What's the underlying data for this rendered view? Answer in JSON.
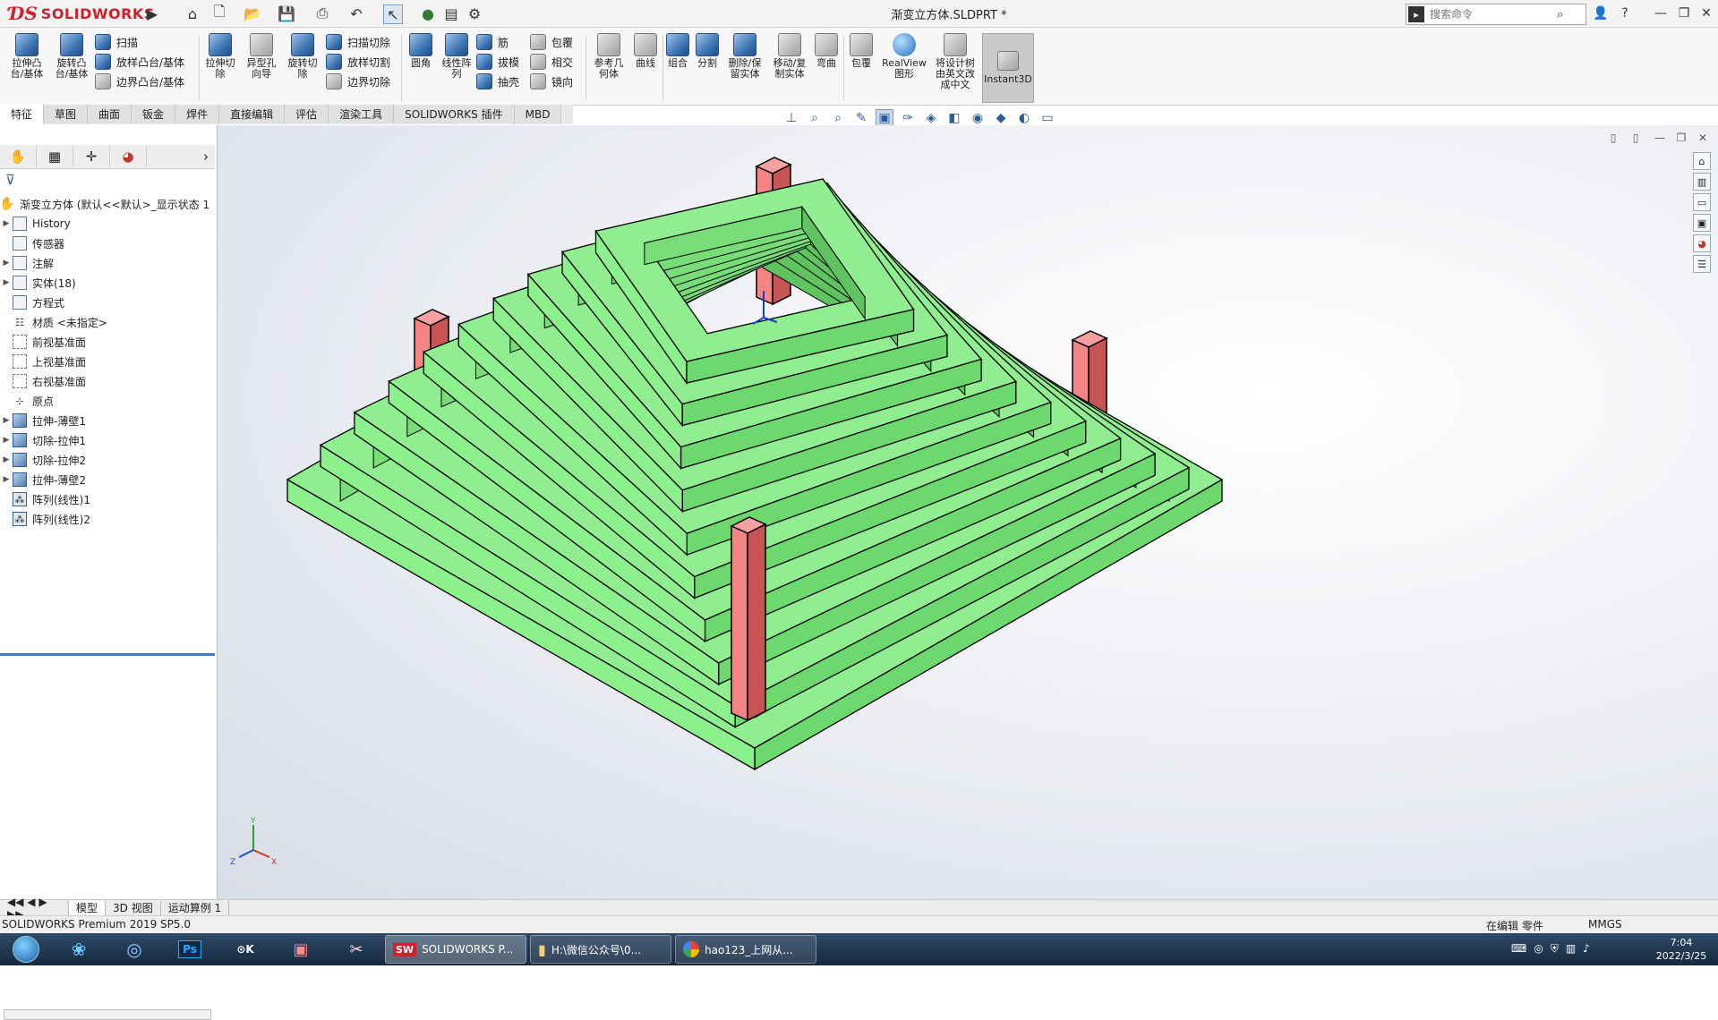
{
  "app": {
    "brand": "SOLIDWORKS",
    "doc_title": "渐变立方体.SLDPRT *"
  },
  "search": {
    "placeholder": "搜索命令"
  },
  "ribbon": {
    "extrude_boss": "拉伸凸\n台/基体",
    "revolve_boss": "旋转凸\n台/基体",
    "sweep": "扫描",
    "loft_boss": "放样凸台/基体",
    "boundary_boss": "边界凸台/基体",
    "extrude_cut": "拉伸切\n除",
    "hole_wizard": "异型孔\n向导",
    "revolve_cut": "旋转切\n除",
    "swept_cut": "扫描切除",
    "lofted_cut": "放样切割",
    "boundary_cut": "边界切除",
    "fillet": "圆角",
    "linear_pattern": "线性阵\n列",
    "rib": "筋",
    "draft": "拔模",
    "shell": "抽壳",
    "wrap": "包覆",
    "intersect": "相交",
    "mirror": "镜向",
    "ref_geometry": "参考几\n何体",
    "curves": "曲线",
    "combine": "组合",
    "split": "分割",
    "delete_keep": "删除/保\n留实体",
    "move_copy": "移动/复\n制实体",
    "flex": "弯曲",
    "wrap2": "包覆",
    "realview": "RealView\n图形",
    "translate": "将设计树\n由英文改\n成中文",
    "instant3d": "Instant3D"
  },
  "command_tabs": [
    "特征",
    "草图",
    "曲面",
    "钣金",
    "焊件",
    "直接编辑",
    "评估",
    "渲染工具",
    "SOLIDWORKS 插件",
    "MBD"
  ],
  "tree": {
    "root": "渐变立方体 (默认<<默认>_显示状态 1",
    "items": [
      {
        "label": "History",
        "expand": "▶",
        "icon": "folder"
      },
      {
        "label": "传感器",
        "expand": "",
        "icon": "folder"
      },
      {
        "label": "注解",
        "expand": "▶",
        "icon": "folder"
      },
      {
        "label": "实体(18)",
        "expand": "▶",
        "icon": "folder"
      },
      {
        "label": "方程式",
        "expand": "",
        "icon": "folder"
      },
      {
        "label": "材质 <未指定>",
        "expand": "",
        "icon": "material"
      },
      {
        "label": "前视基准面",
        "expand": "",
        "icon": "plane"
      },
      {
        "label": "上视基准面",
        "expand": "",
        "icon": "plane"
      },
      {
        "label": "右视基准面",
        "expand": "",
        "icon": "plane"
      },
      {
        "label": "原点",
        "expand": "",
        "icon": "origin"
      },
      {
        "label": "拉伸-薄壁1",
        "expand": "▶",
        "icon": "feature"
      },
      {
        "label": "切除-拉伸1",
        "expand": "▶",
        "icon": "feature"
      },
      {
        "label": "切除-拉伸2",
        "expand": "▶",
        "icon": "feature"
      },
      {
        "label": "拉伸-薄壁2",
        "expand": "▶",
        "icon": "feature"
      },
      {
        "label": "阵列(线性)1",
        "expand": "",
        "icon": "pattern"
      },
      {
        "label": "阵列(线性)2",
        "expand": "",
        "icon": "pattern"
      }
    ]
  },
  "bottom_tabs": [
    "模型",
    "3D 视图",
    "运动算例 1"
  ],
  "status": {
    "product": "SOLIDWORKS Premium 2019 SP5.0",
    "editing": "在编辑 零件",
    "units": "MMGS"
  },
  "taskbar": {
    "windows": [
      {
        "label": "SOLIDWORKS P...",
        "active": true
      },
      {
        "label": "H:\\微信公众号\\0...",
        "active": false
      },
      {
        "label": "hao123_上网从...",
        "active": false
      }
    ],
    "time": "7:04",
    "date": "2022/3/25"
  },
  "triad": {
    "x": "X",
    "y": "Y",
    "z": "Z"
  },
  "colors": {
    "frame": "#f08080",
    "rings": "#8cf08c",
    "accent": "#d21f2c"
  }
}
